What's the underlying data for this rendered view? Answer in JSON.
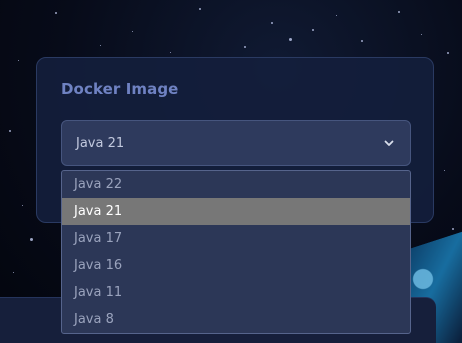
{
  "docker_image": {
    "title": "Docker Image",
    "selected_value": "Java 21",
    "options": [
      {
        "label": "Java 22",
        "selected": false
      },
      {
        "label": "Java 21",
        "selected": true
      },
      {
        "label": "Java 17",
        "selected": false
      },
      {
        "label": "Java 16",
        "selected": false
      },
      {
        "label": "Java 11",
        "selected": false
      },
      {
        "label": "Java 8",
        "selected": false
      }
    ]
  },
  "icons": {
    "dropdown": "chevron-down-icon"
  },
  "colors": {
    "card_bg": "#141e3c",
    "title": "#6f82c2",
    "select_bg": "#2e3a5d",
    "option_text": "#9aa3bd",
    "highlight": "#777777"
  }
}
